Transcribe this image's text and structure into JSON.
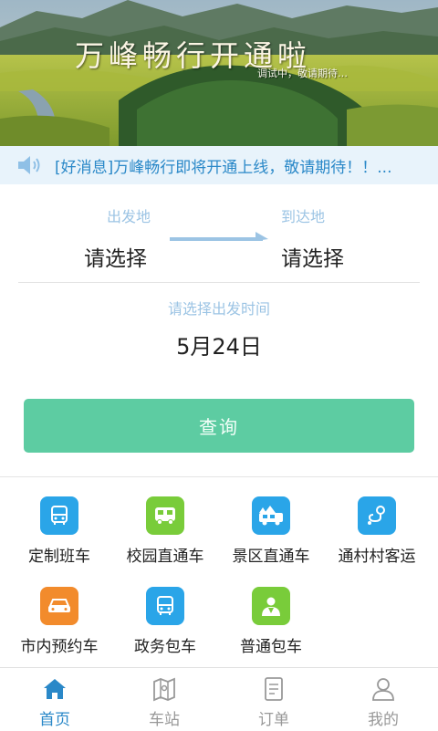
{
  "banner": {
    "title": "万峰畅行开通啦",
    "subtitle": "调试中，敬请期待…"
  },
  "notice": {
    "icon": "speaker-icon",
    "text": "[好消息]万峰畅行即将开通上线，敬请期待！！..."
  },
  "route": {
    "from_label": "出发地",
    "from_value": "请选择",
    "to_label": "到达地",
    "to_value": "请选择"
  },
  "date": {
    "label": "请选择出发时间",
    "value": "5月24日"
  },
  "query_button": "查询",
  "services": [
    {
      "label": "定制班车",
      "icon": "bus-icon",
      "color": "#2aa5e8"
    },
    {
      "label": "校园直通车",
      "icon": "school-bus-icon",
      "color": "#79cc3a"
    },
    {
      "label": "景区直通车",
      "icon": "scenic-bus-icon",
      "color": "#2aa5e8"
    },
    {
      "label": "通村村客运",
      "icon": "village-route-icon",
      "color": "#2aa5e8"
    },
    {
      "label": "市内预约车",
      "icon": "car-icon",
      "color": "#f28b2c"
    },
    {
      "label": "政务包车",
      "icon": "bus-icon",
      "color": "#2aa5e8"
    },
    {
      "label": "普通包车",
      "icon": "driver-icon",
      "color": "#79cc3a"
    }
  ],
  "tabs": [
    {
      "label": "首页",
      "icon": "home-icon",
      "active": true
    },
    {
      "label": "车站",
      "icon": "map-icon",
      "active": false
    },
    {
      "label": "订单",
      "icon": "order-icon",
      "active": false
    },
    {
      "label": "我的",
      "icon": "user-icon",
      "active": false
    }
  ],
  "colors": {
    "accent": "#2a88c8",
    "button": "#5dcca2",
    "label": "#9cc4e4"
  }
}
